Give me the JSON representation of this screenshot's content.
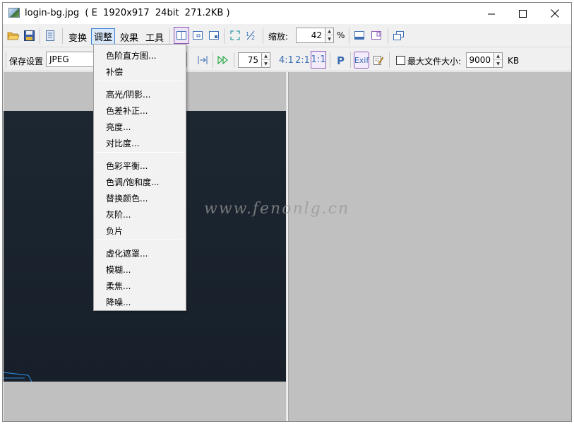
{
  "window": {
    "title": "login-bg.jpg  ( E  1920x917  24bit  271.2KB )"
  },
  "toolbar": {
    "menus": [
      "变换",
      "调整",
      "效果",
      "工具"
    ],
    "active_menu": "调整",
    "zoom_label": "缩放:",
    "zoom_value": "42",
    "zoom_unit": "%"
  },
  "save_bar": {
    "label": "保存设置",
    "format": "JPEG",
    "quality": "75",
    "ratio_4_1": "4:1",
    "ratio_2_1": "2:1",
    "ratio_1_1": "1:1",
    "p_label": "P",
    "exif_label": "Exif",
    "max_size_label": "最大文件大小:",
    "max_size_value": "9000",
    "max_size_unit": "KB",
    "max_size_checked": false
  },
  "adjust_menu": {
    "items": [
      "色阶直方图...",
      "补偿",
      "高光/阴影...",
      "色差补正...",
      "亮度...",
      "对比度...",
      "色彩平衡...",
      "色调/饱和度...",
      "替换颜色...",
      "灰阶...",
      "负片",
      "虚化遮罩...",
      "模糊...",
      "柔焦...",
      "降噪..."
    ]
  },
  "watermark": "www.fenonlg.cn",
  "colors": {
    "accent": "#3c7fd8",
    "image_bg": "#1b242e",
    "pane_bg": "#c0c0c0"
  }
}
